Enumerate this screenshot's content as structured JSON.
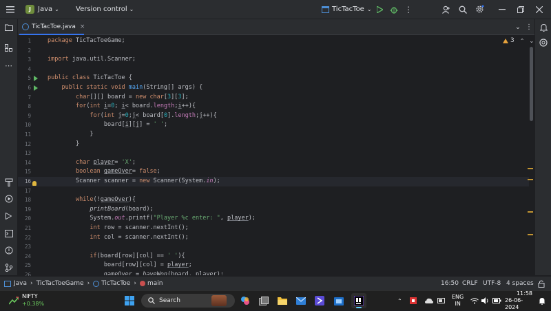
{
  "titlebar": {
    "project_initial": "J",
    "project_name": "Java",
    "vcs_label": "Version control",
    "run_config": "TicTacToe"
  },
  "tab": {
    "filename": "TicTacToe.java"
  },
  "editor": {
    "warnings_count": "3",
    "current_line": 16,
    "lines": [
      {
        "n": "1",
        "html": "<span class=\"kw\">package</span> TicTacToeGame;"
      },
      {
        "n": "2",
        "html": ""
      },
      {
        "n": "3",
        "html": "<span class=\"kw\">import</span> java.util.Scanner;"
      },
      {
        "n": "4",
        "html": ""
      },
      {
        "n": "5",
        "html": "<span class=\"kw\">public class</span> TicTacToe {"
      },
      {
        "n": "6",
        "html": "    <span class=\"kw\">public static void</span> <span class=\"fn\">main</span>(String[] args) {"
      },
      {
        "n": "7",
        "html": "        <span class=\"kw\">char</span>[][] board = <span class=\"kw\">new char</span>[<span class=\"num\">3</span>][<span class=\"num\">3</span>];"
      },
      {
        "n": "8",
        "html": "        <span class=\"kw\">for</span>(<span class=\"kw\">int</span> <span class=\"ul\">i</span>=<span class=\"num\">0</span>; <span class=\"ul\">i</span>&lt; board.<span class=\"fld\">length</span>;<span class=\"ul\">i</span>++){"
      },
      {
        "n": "9",
        "html": "            <span class=\"kw\">for</span>(<span class=\"kw\">int</span> <span class=\"ul\">j</span>=<span class=\"num\">0</span>;<span class=\"ul\">j</span>&lt; board[<span class=\"num\">0</span>].<span class=\"fld\">length</span>;<span class=\"ul\">j</span>++){"
      },
      {
        "n": "10",
        "html": "                board[<span class=\"ul\">i</span>][<span class=\"ul\">j</span>] = <span class=\"str\">' '</span>;"
      },
      {
        "n": "11",
        "html": "            }"
      },
      {
        "n": "12",
        "html": "        }"
      },
      {
        "n": "13",
        "html": ""
      },
      {
        "n": "14",
        "html": "        <span class=\"kw\">char</span> <span class=\"ul\">player</span>= <span class=\"str\">'X'</span>;"
      },
      {
        "n": "15",
        "html": "        <span class=\"kw\">boolean</span> <span class=\"ul\">gameOver</span>= <span class=\"kw\">false</span>;"
      },
      {
        "n": "16",
        "html": "        Scanner scanner = <span class=\"kw\">new</span> Scanner(System.<span class=\"fld it\">in</span>);"
      },
      {
        "n": "17",
        "html": ""
      },
      {
        "n": "18",
        "html": "        <span class=\"kw\">while</span>(!<span class=\"ul\">gameOver</span>){"
      },
      {
        "n": "19",
        "html": "            <span class=\"it\">printBoard</span>(board);"
      },
      {
        "n": "20",
        "html": "            System.<span class=\"fld it\">out</span>.printf(<span class=\"str\">\"Player %c enter: \"</span>, <span class=\"ul\">player</span>);"
      },
      {
        "n": "21",
        "html": "            <span class=\"kw\">int</span> row = scanner.nextInt();"
      },
      {
        "n": "22",
        "html": "            <span class=\"kw\">int</span> col = scanner.nextInt();"
      },
      {
        "n": "23",
        "html": ""
      },
      {
        "n": "24",
        "html": "            <span class=\"kw\">if</span>(board[row][col] == <span class=\"str\">' '</span>){"
      },
      {
        "n": "25",
        "html": "                board[row][col] = <span class=\"ul\">player</span>;"
      },
      {
        "n": "26",
        "html": "                <span class=\"ul\">gameOver</span> = <span class=\"it\">haveWon</span>(board, <span class=\"ul\">player</span>);"
      }
    ]
  },
  "breadcrumb": {
    "items": [
      "Java",
      "TicTacToeGame",
      "TicTacToe",
      "main"
    ]
  },
  "status": {
    "position": "16:50",
    "line_sep": "CRLF",
    "encoding": "UTF-8",
    "indent": "4 spaces"
  },
  "taskbar": {
    "ticker_name": "NIFTY",
    "ticker_change": "+0.38%",
    "search_label": "Search",
    "lang_line1": "ENG",
    "lang_line2": "IN",
    "time": "11:58",
    "date": "26-06-2024"
  },
  "colors": {
    "accent": "#3574f0",
    "run_green": "#5fb865",
    "warning": "#e6a23c",
    "ticker_green": "#6ccb5f"
  }
}
